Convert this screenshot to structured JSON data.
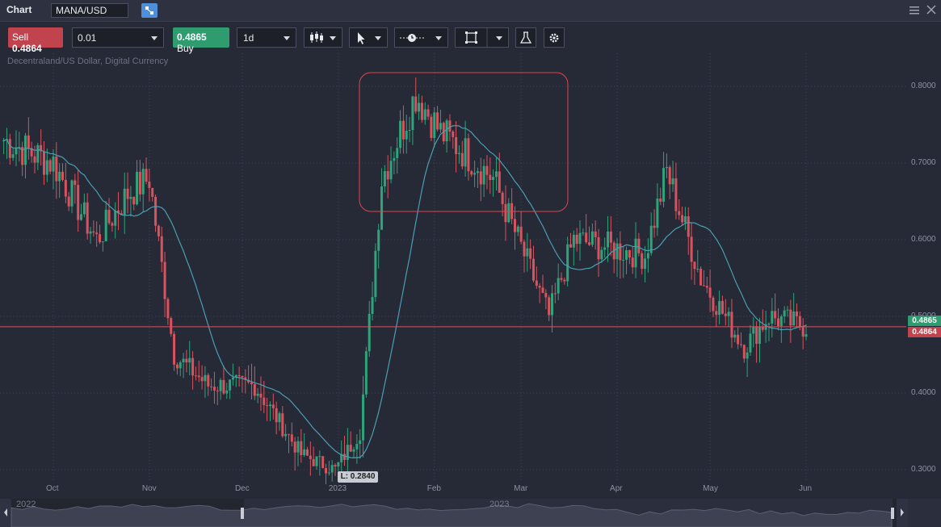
{
  "app": {
    "title": "Chart",
    "symbol": "MANA/USD"
  },
  "toolbar": {
    "sell_label": "Sell",
    "sell_price": "0.4864",
    "quantity": "0.01",
    "buy_price": "0.4865",
    "buy_label": "Buy",
    "timeframe": "1d"
  },
  "instrument_description": "Decentraland/US Dollar, Digital Currency",
  "colors": {
    "bull": "#2fa37b",
    "bear": "#d9535f",
    "ma": "#4a9fb3",
    "highlight": "#e0454f",
    "bg": "#262936"
  },
  "icons": [
    "candles-icon",
    "cursor-icon",
    "line-tool-icon",
    "rectangle-tool-icon",
    "flask-icon",
    "gear-icon",
    "menu-icon",
    "close-icon",
    "link-icon"
  ],
  "chart": {
    "y_ticks": [
      "0.8000",
      "0.7000",
      "0.6000",
      "0.5000",
      "0.4000",
      "0.3000"
    ],
    "x_ticks": [
      "Oct",
      "Nov",
      "Dec",
      "2023",
      "Feb",
      "Mar",
      "Apr",
      "May",
      "Jun"
    ],
    "ask_price": "0.4865",
    "bid_price": "0.4864",
    "low_label": "L: 0.2840",
    "navigator_labels": [
      "2022",
      "2023"
    ]
  },
  "chart_data": {
    "type": "candlestick",
    "interval": "1d",
    "ylim": [
      0.28,
      0.84
    ],
    "series": [
      {
        "name": "MANA/USD",
        "values": [
          {
            "date": "2022-09-15",
            "close": 0.73
          },
          {
            "date": "2022-10-01",
            "close": 0.7
          },
          {
            "date": "2022-10-15",
            "close": 0.6
          },
          {
            "date": "2022-10-25",
            "close": 0.66
          },
          {
            "date": "2022-11-01",
            "close": 0.68
          },
          {
            "date": "2022-11-09",
            "close": 0.45
          },
          {
            "date": "2022-11-20",
            "close": 0.41
          },
          {
            "date": "2022-12-05",
            "close": 0.41
          },
          {
            "date": "2022-12-20",
            "close": 0.32
          },
          {
            "date": "2022-12-31",
            "close": 0.3
          },
          {
            "date": "2023-01-08",
            "close": 0.35
          },
          {
            "date": "2023-01-15",
            "close": 0.68
          },
          {
            "date": "2023-01-26",
            "close": 0.79
          },
          {
            "date": "2023-02-03",
            "close": 0.74
          },
          {
            "date": "2023-02-12",
            "close": 0.71
          },
          {
            "date": "2023-02-20",
            "close": 0.68
          },
          {
            "date": "2023-03-10",
            "close": 0.5
          },
          {
            "date": "2023-03-18",
            "close": 0.6
          },
          {
            "date": "2023-04-10",
            "close": 0.58
          },
          {
            "date": "2023-04-17",
            "close": 0.69
          },
          {
            "date": "2023-04-28",
            "close": 0.55
          },
          {
            "date": "2023-05-12",
            "close": 0.46
          },
          {
            "date": "2023-05-20",
            "close": 0.5
          },
          {
            "date": "2023-06-01",
            "close": 0.4865
          }
        ]
      }
    ],
    "overlays": [
      "moving average",
      "highlight rectangle"
    ]
  }
}
